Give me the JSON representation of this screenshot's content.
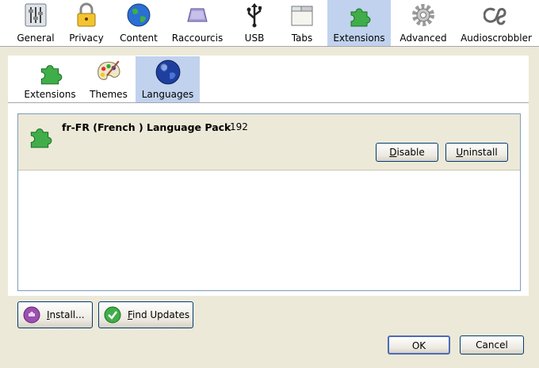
{
  "toolbar": {
    "items": [
      {
        "label": "General",
        "icon": "sliders-icon"
      },
      {
        "label": "Privacy",
        "icon": "padlock-icon"
      },
      {
        "label": "Content",
        "icon": "globe-icon"
      },
      {
        "label": "Raccourcis",
        "icon": "keyboard-key-icon"
      },
      {
        "label": "USB",
        "icon": "usb-icon"
      },
      {
        "label": "Tabs",
        "icon": "tabs-icon"
      },
      {
        "label": "Extensions",
        "icon": "puzzle-icon"
      },
      {
        "label": "Advanced",
        "icon": "gear-icon"
      },
      {
        "label": "Audioscrobbler",
        "icon": "lastfm-icon"
      }
    ],
    "selected": "Extensions"
  },
  "subtabs": {
    "items": [
      {
        "label": "Extensions",
        "icon": "puzzle-icon"
      },
      {
        "label": "Themes",
        "icon": "palette-icon"
      },
      {
        "label": "Languages",
        "icon": "globe-icon"
      }
    ],
    "selected": "Languages"
  },
  "extension": {
    "name": "fr-FR (French ) Language Pack",
    "version": "192",
    "disable_label": "Disable",
    "disable_key": "D",
    "uninstall_label": "Uninstall",
    "uninstall_key": "U"
  },
  "footer": {
    "install_label": "Install...",
    "install_key": "I",
    "find_updates_label": "Find Updates",
    "find_updates_key": "F",
    "ok_label": "OK",
    "cancel_label": "Cancel"
  },
  "colors": {
    "window_bg": "#ece9d8",
    "selected_bg": "#c1d2ee",
    "puzzle_green": "#3fae49"
  }
}
